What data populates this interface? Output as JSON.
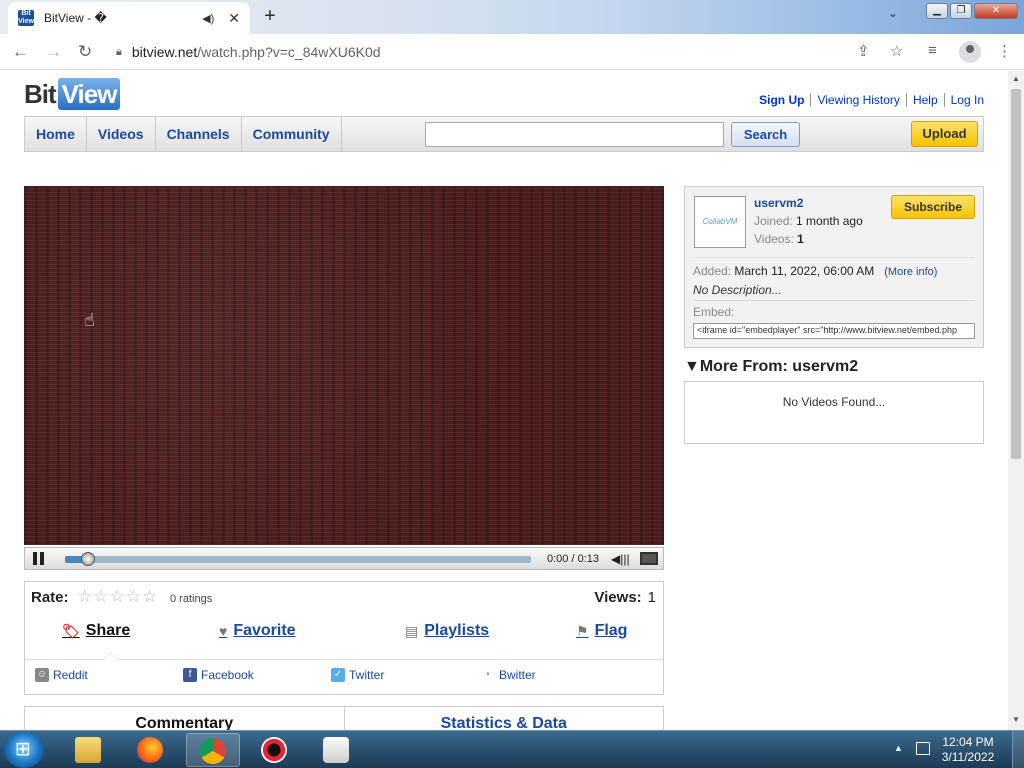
{
  "browser": {
    "tab_title": "BitView - �",
    "favicon_text": "Bit View",
    "url_host": "bitview.net",
    "url_path": "/watch.php?v=c_84wXU6K0d"
  },
  "site": {
    "logo_bit": "Bit",
    "logo_view": "View",
    "top_links": [
      "Sign Up",
      "Viewing History",
      "Help",
      "Log In"
    ],
    "nav": [
      "Home",
      "Videos",
      "Channels",
      "Community"
    ],
    "search_button": "Search",
    "upload_button": "Upload",
    "accent": "#1a4aa0"
  },
  "player": {
    "current_time": "0:00",
    "duration": "0:13",
    "time_label": "0:00 / 0:13",
    "progress": 0.05
  },
  "rating": {
    "label": "Rate:",
    "count_text": "0 ratings",
    "views_label": "Views:",
    "views_value": "1",
    "actions": [
      "Share",
      "Favorite",
      "Playlists",
      "Flag"
    ],
    "social": [
      "Reddit",
      "Facebook",
      "Twitter",
      "Bwitter"
    ]
  },
  "info_tabs": [
    "Commentary",
    "Statistics & Data"
  ],
  "uploader": {
    "thumb_text": "CollabVM",
    "name": "uservm2",
    "joined_label": "Joined:",
    "joined_value": "1 month ago",
    "videos_label": "Videos:",
    "videos_value": "1",
    "subscribe": "Subscribe",
    "added_label": "Added:",
    "added_value": "March 11, 2022, 06:00 AM",
    "more_info": "(More info)",
    "description": "No Description...",
    "embed_label": "Embed:",
    "embed_code": "<iframe id=\"embedplayer\" src=\"http://www.bitview.net/embed.php"
  },
  "more_from": {
    "title": "More From: uservm2",
    "empty": "No Videos Found..."
  },
  "taskbar": {
    "time": "12:04 PM",
    "date": "3/11/2022"
  }
}
